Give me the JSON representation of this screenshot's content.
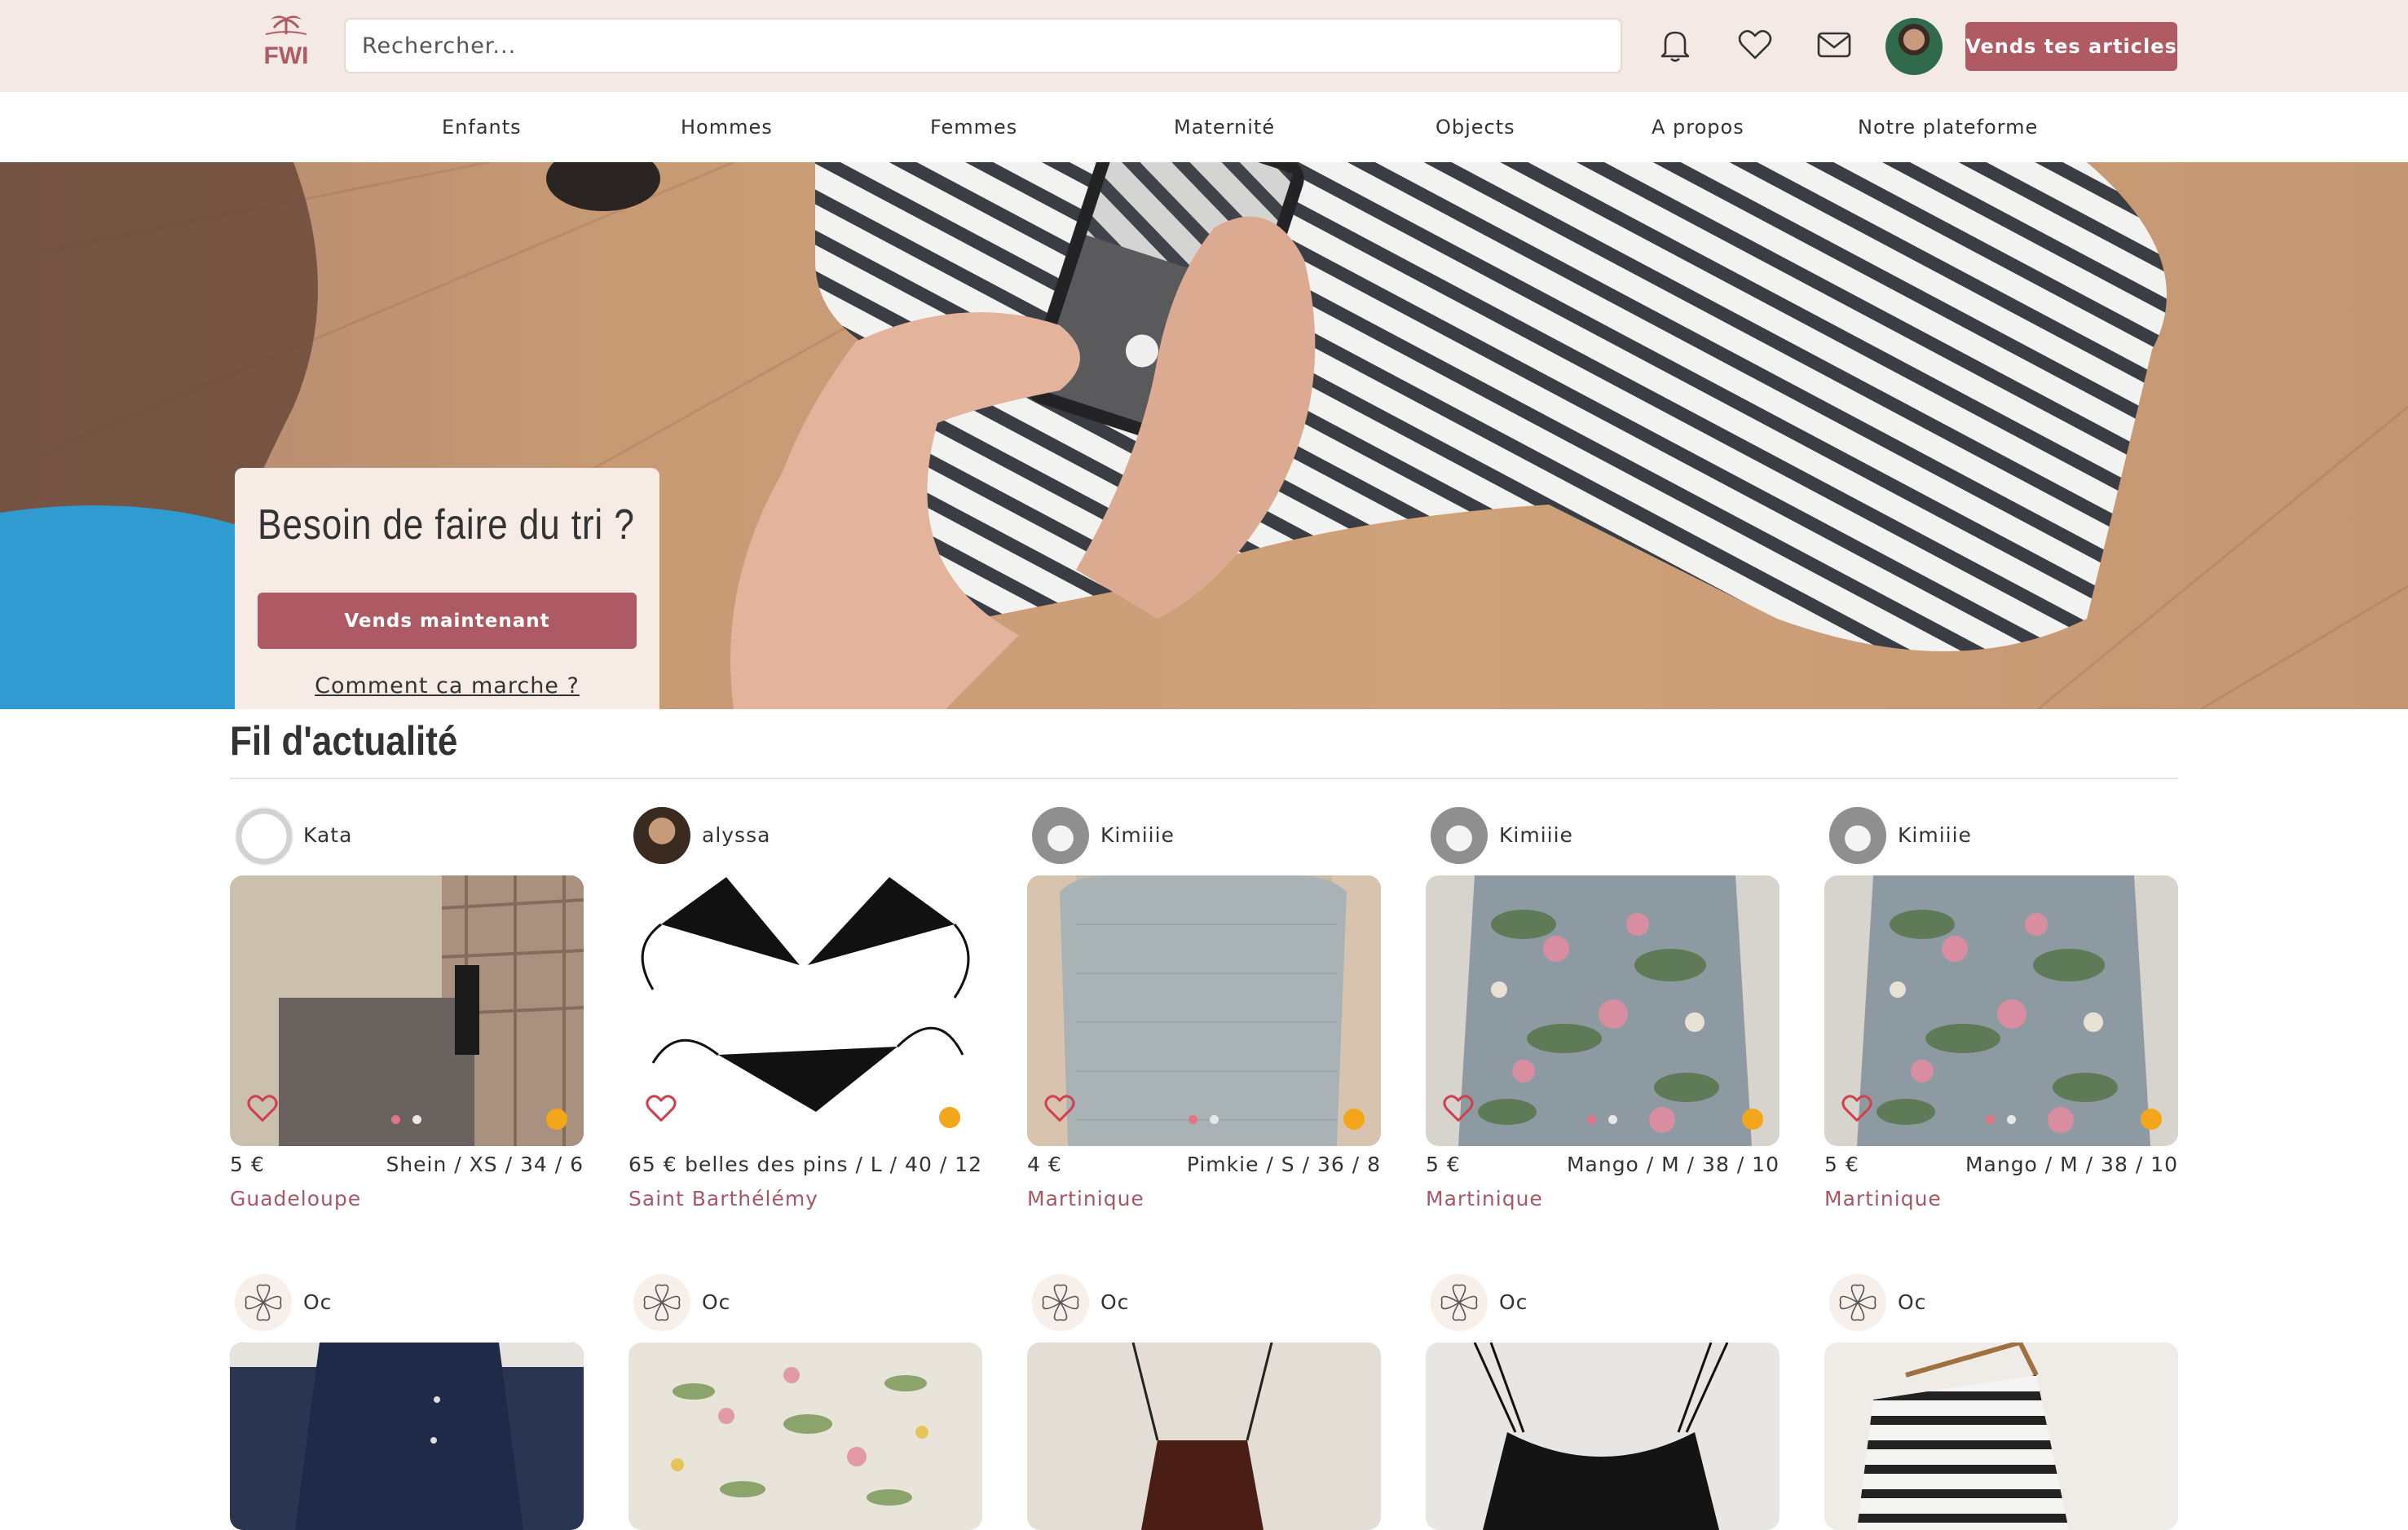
{
  "header": {
    "logo_text": "FWI",
    "search_placeholder": "Rechercher...",
    "sell_button": "Vends tes articles",
    "icons": [
      "bell-icon",
      "heart-icon",
      "mail-icon"
    ]
  },
  "nav": {
    "items": [
      "Enfants",
      "Hommes",
      "Femmes",
      "Maternité",
      "Objects",
      "A propos",
      "Notre plateforme"
    ]
  },
  "hero": {
    "title": "Besoin de faire du tri ?",
    "button": "Vends maintenant",
    "link": "Comment ca marche ?"
  },
  "feed": {
    "title": "Fil d'actualité",
    "row1": [
      {
        "seller": "Kata",
        "price": "5 €",
        "meta": "Shein / XS / 34 / 6",
        "location": "Guadeloupe"
      },
      {
        "seller": "alyssa",
        "price": "65 €",
        "meta": "belles des pins / L / 40 / 12",
        "location": "Saint Barthélémy"
      },
      {
        "seller": "Kimiiie",
        "price": "4 €",
        "meta": "Pimkie / S / 36 / 8",
        "location": "Martinique"
      },
      {
        "seller": "Kimiiie",
        "price": "5 €",
        "meta": "Mango / M / 38 / 10",
        "location": "Martinique"
      },
      {
        "seller": "Kimiiie",
        "price": "5 €",
        "meta": "Mango / M / 38 / 10",
        "location": "Martinique"
      }
    ],
    "row2": [
      {
        "seller": "Oc"
      },
      {
        "seller": "Oc"
      },
      {
        "seller": "Oc"
      },
      {
        "seller": "Oc"
      },
      {
        "seller": "Oc"
      }
    ]
  },
  "colors": {
    "brand": "#b05a64",
    "header_bg": "#f4e9e4",
    "location_text": "#a65864",
    "boost_badge": "#f3a61a"
  }
}
